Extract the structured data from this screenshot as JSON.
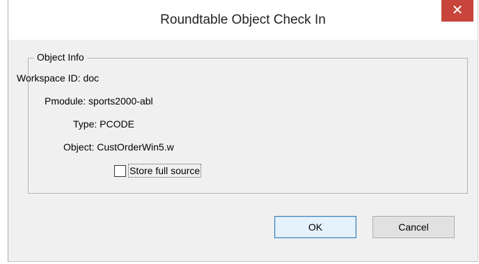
{
  "window": {
    "title": "Roundtable Object Check In",
    "close_glyph": "✕"
  },
  "object_info": {
    "legend": "Object Info",
    "fields": [
      {
        "label": "Workspace ID:",
        "value": "doc"
      },
      {
        "label": "Pmodule:",
        "value": "sports2000-abl"
      },
      {
        "label": "Type:",
        "value": "PCODE"
      },
      {
        "label": "Object:",
        "value": "CustOrderWin5.w"
      }
    ],
    "store_full_source": {
      "label": "Store full source",
      "checked": false
    }
  },
  "buttons": {
    "ok": "OK",
    "cancel": "Cancel"
  },
  "colors": {
    "close_button": "#c7453a",
    "dialog_bg": "#f0f0f0",
    "ok_border": "#3c7fb1"
  }
}
